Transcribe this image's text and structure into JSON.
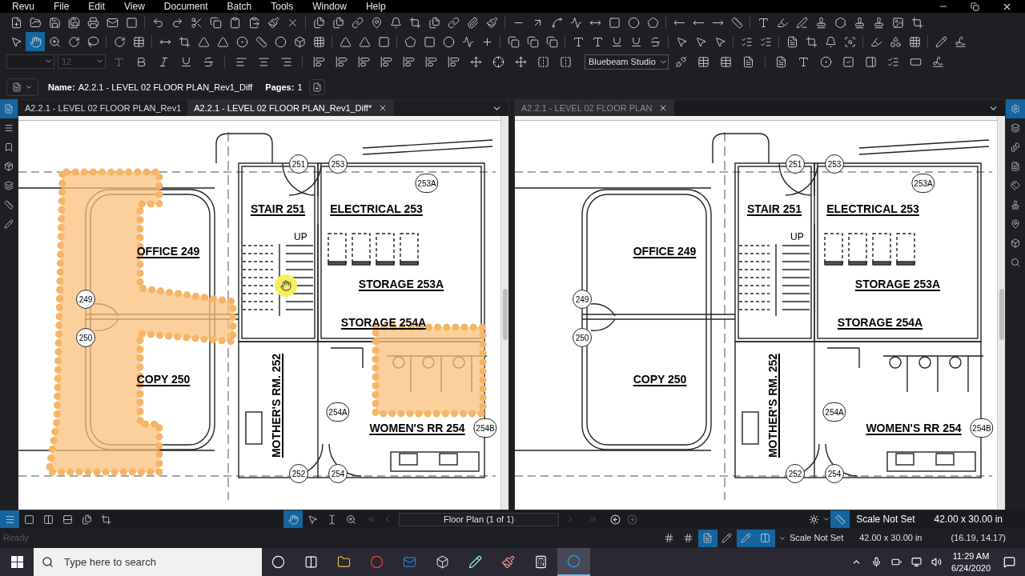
{
  "menu": [
    "Revu",
    "File",
    "Edit",
    "View",
    "Document",
    "Batch",
    "Tools",
    "Window",
    "Help"
  ],
  "drawing_tools": [
    {
      "selected": false
    },
    {
      "selected": true
    },
    {
      "selected": false
    },
    {
      "selected": false
    },
    {
      "selected": false
    }
  ],
  "font_size_field": {
    "placeholder": "12"
  },
  "studio_dropdown": {
    "value": "Bluebeam Studio"
  },
  "document_bar": {
    "name_label": "Name:",
    "name": "A2.2.1 - LEVEL 02 FLOOR PLAN_Rev1_Diff",
    "pages_label": "Pages:",
    "pages": "1"
  },
  "side_tabs_left": [
    {
      "selected": true
    },
    {
      "selected": false
    },
    {
      "selected": false
    },
    {
      "selected": false
    },
    {
      "selected": false
    },
    {
      "selected": false
    },
    {
      "selected": false
    }
  ],
  "side_tabs_right": [
    {
      "selected": true
    },
    {
      "selected": false
    },
    {
      "selected": false
    },
    {
      "selected": false
    },
    {
      "selected": false
    },
    {
      "selected": false
    },
    {
      "selected": false
    },
    {
      "selected": false
    },
    {
      "selected": false
    }
  ],
  "panels": [
    {
      "focused": true,
      "show_diff_clouds": true,
      "tabs": [
        {
          "label": "A2.2.1 - LEVEL 02 FLOOR PLAN_Rev1",
          "selected": false
        },
        {
          "label": "A2.2.1 - LEVEL 02 FLOOR PLAN_Rev1_Diff*",
          "selected": true
        }
      ],
      "rooms": [
        "STAIR 251",
        "ELECTRICAL 253",
        "OFFICE 249",
        "STORAGE 253A",
        "STORAGE 254A",
        "COPY 250",
        "MOTHER'S RM. 252",
        "WOMEN'S RR 254"
      ],
      "note": "UP",
      "tags": [
        "251",
        "253",
        "253A",
        "249",
        "250",
        "254A",
        "254B",
        "252",
        "254"
      ]
    },
    {
      "focused": false,
      "show_diff_clouds": false,
      "tabs": [
        {
          "label": "A2.2.1 - LEVEL 02 FLOOR PLAN",
          "selected": true
        }
      ],
      "rooms": [
        "STAIR 251",
        "ELECTRICAL 253",
        "OFFICE 249",
        "STORAGE 253A",
        "STORAGE 254A",
        "COPY 250",
        "MOTHER'S RM. 252",
        "WOMEN'S RR 254"
      ],
      "note": "UP",
      "tags": [
        "251",
        "253",
        "253A",
        "249",
        "250",
        "254A",
        "254B",
        "252",
        "254"
      ]
    }
  ],
  "view_buttons": [
    {
      "selected": true
    },
    {
      "selected": false
    },
    {
      "selected": false
    },
    {
      "selected": false
    },
    {
      "selected": false
    },
    {
      "selected": false
    }
  ],
  "nav_tools": [
    {
      "selected": true
    },
    {
      "selected": false
    },
    {
      "selected": false
    },
    {
      "selected": false
    }
  ],
  "page_field": {
    "value": "Floor Plan (1 of 1)"
  },
  "calibrate": {
    "selected": true
  },
  "nav_scale": "Scale Not Set",
  "nav_size": "42.00 x 30.00 in",
  "status": {
    "text": "Ready",
    "toggles": [
      {
        "selected": false
      },
      {
        "selected": false
      },
      {
        "selected": true
      },
      {
        "selected": false
      },
      {
        "selected": true
      },
      {
        "selected": true
      }
    ],
    "scale": "Scale Not Set",
    "size": "42.00 x 30.00 in",
    "coordinates": "(16.19, 14.17)"
  },
  "taskbar": {
    "search_placeholder": "Type here to search",
    "apps": [
      {
        "selected": false
      },
      {
        "selected": false
      },
      {
        "selected": false
      },
      {
        "selected": false
      },
      {
        "selected": false
      },
      {
        "selected": false
      },
      {
        "selected": false
      },
      {
        "selected": false
      },
      {
        "selected": false
      },
      {
        "selected": true
      }
    ],
    "time": "11:29 AM",
    "date": "6/24/2020"
  }
}
